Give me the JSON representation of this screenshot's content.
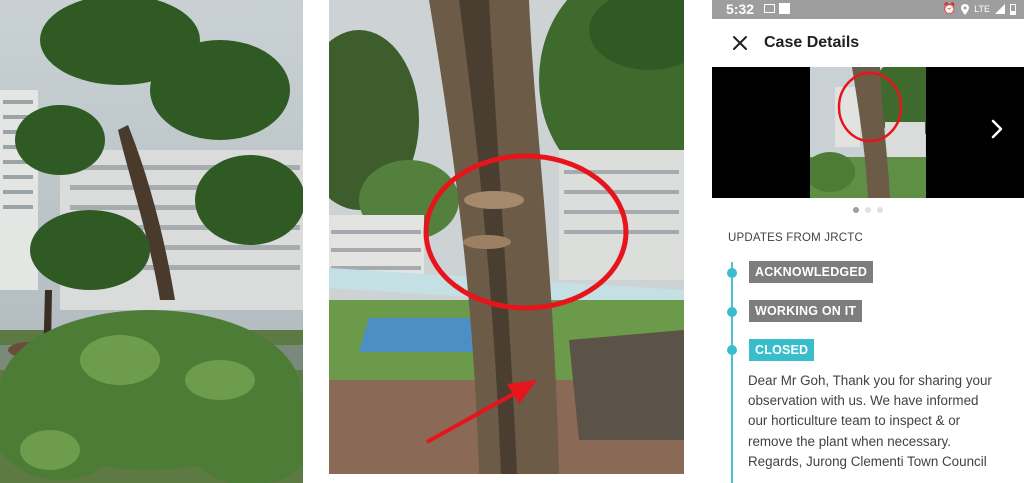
{
  "status_bar": {
    "time": "5:32",
    "network": "LTE",
    "icons": [
      "message-icon",
      "square-icon",
      "alarm-icon",
      "location-icon",
      "signal-icon",
      "battery-icon"
    ]
  },
  "app_bar": {
    "title": "Case Details",
    "close_icon": "close-icon"
  },
  "carousel": {
    "page_count": 3,
    "active_index": 0,
    "next_icon": "chevron-right-icon"
  },
  "updates": {
    "heading": "UPDATES FROM JRCTC",
    "items": [
      {
        "label": "ACKNOWLEDGED",
        "color": "#7d7d7d"
      },
      {
        "label": "WORKING ON IT",
        "color": "#7d7d7d"
      },
      {
        "label": "CLOSED",
        "color": "#39bdca"
      }
    ],
    "message_lines": [
      "Dear Mr Goh, Thank you for sharing your",
      "observation with us. We have informed",
      "our horticulture team to inspect & or",
      "remove the plant when necessary.",
      "Regards, Jurong Clementi Town Council"
    ]
  },
  "colors": {
    "accent": "#39bdca",
    "status_bar": "#9e9e9e",
    "annotation": "#e8141b"
  }
}
